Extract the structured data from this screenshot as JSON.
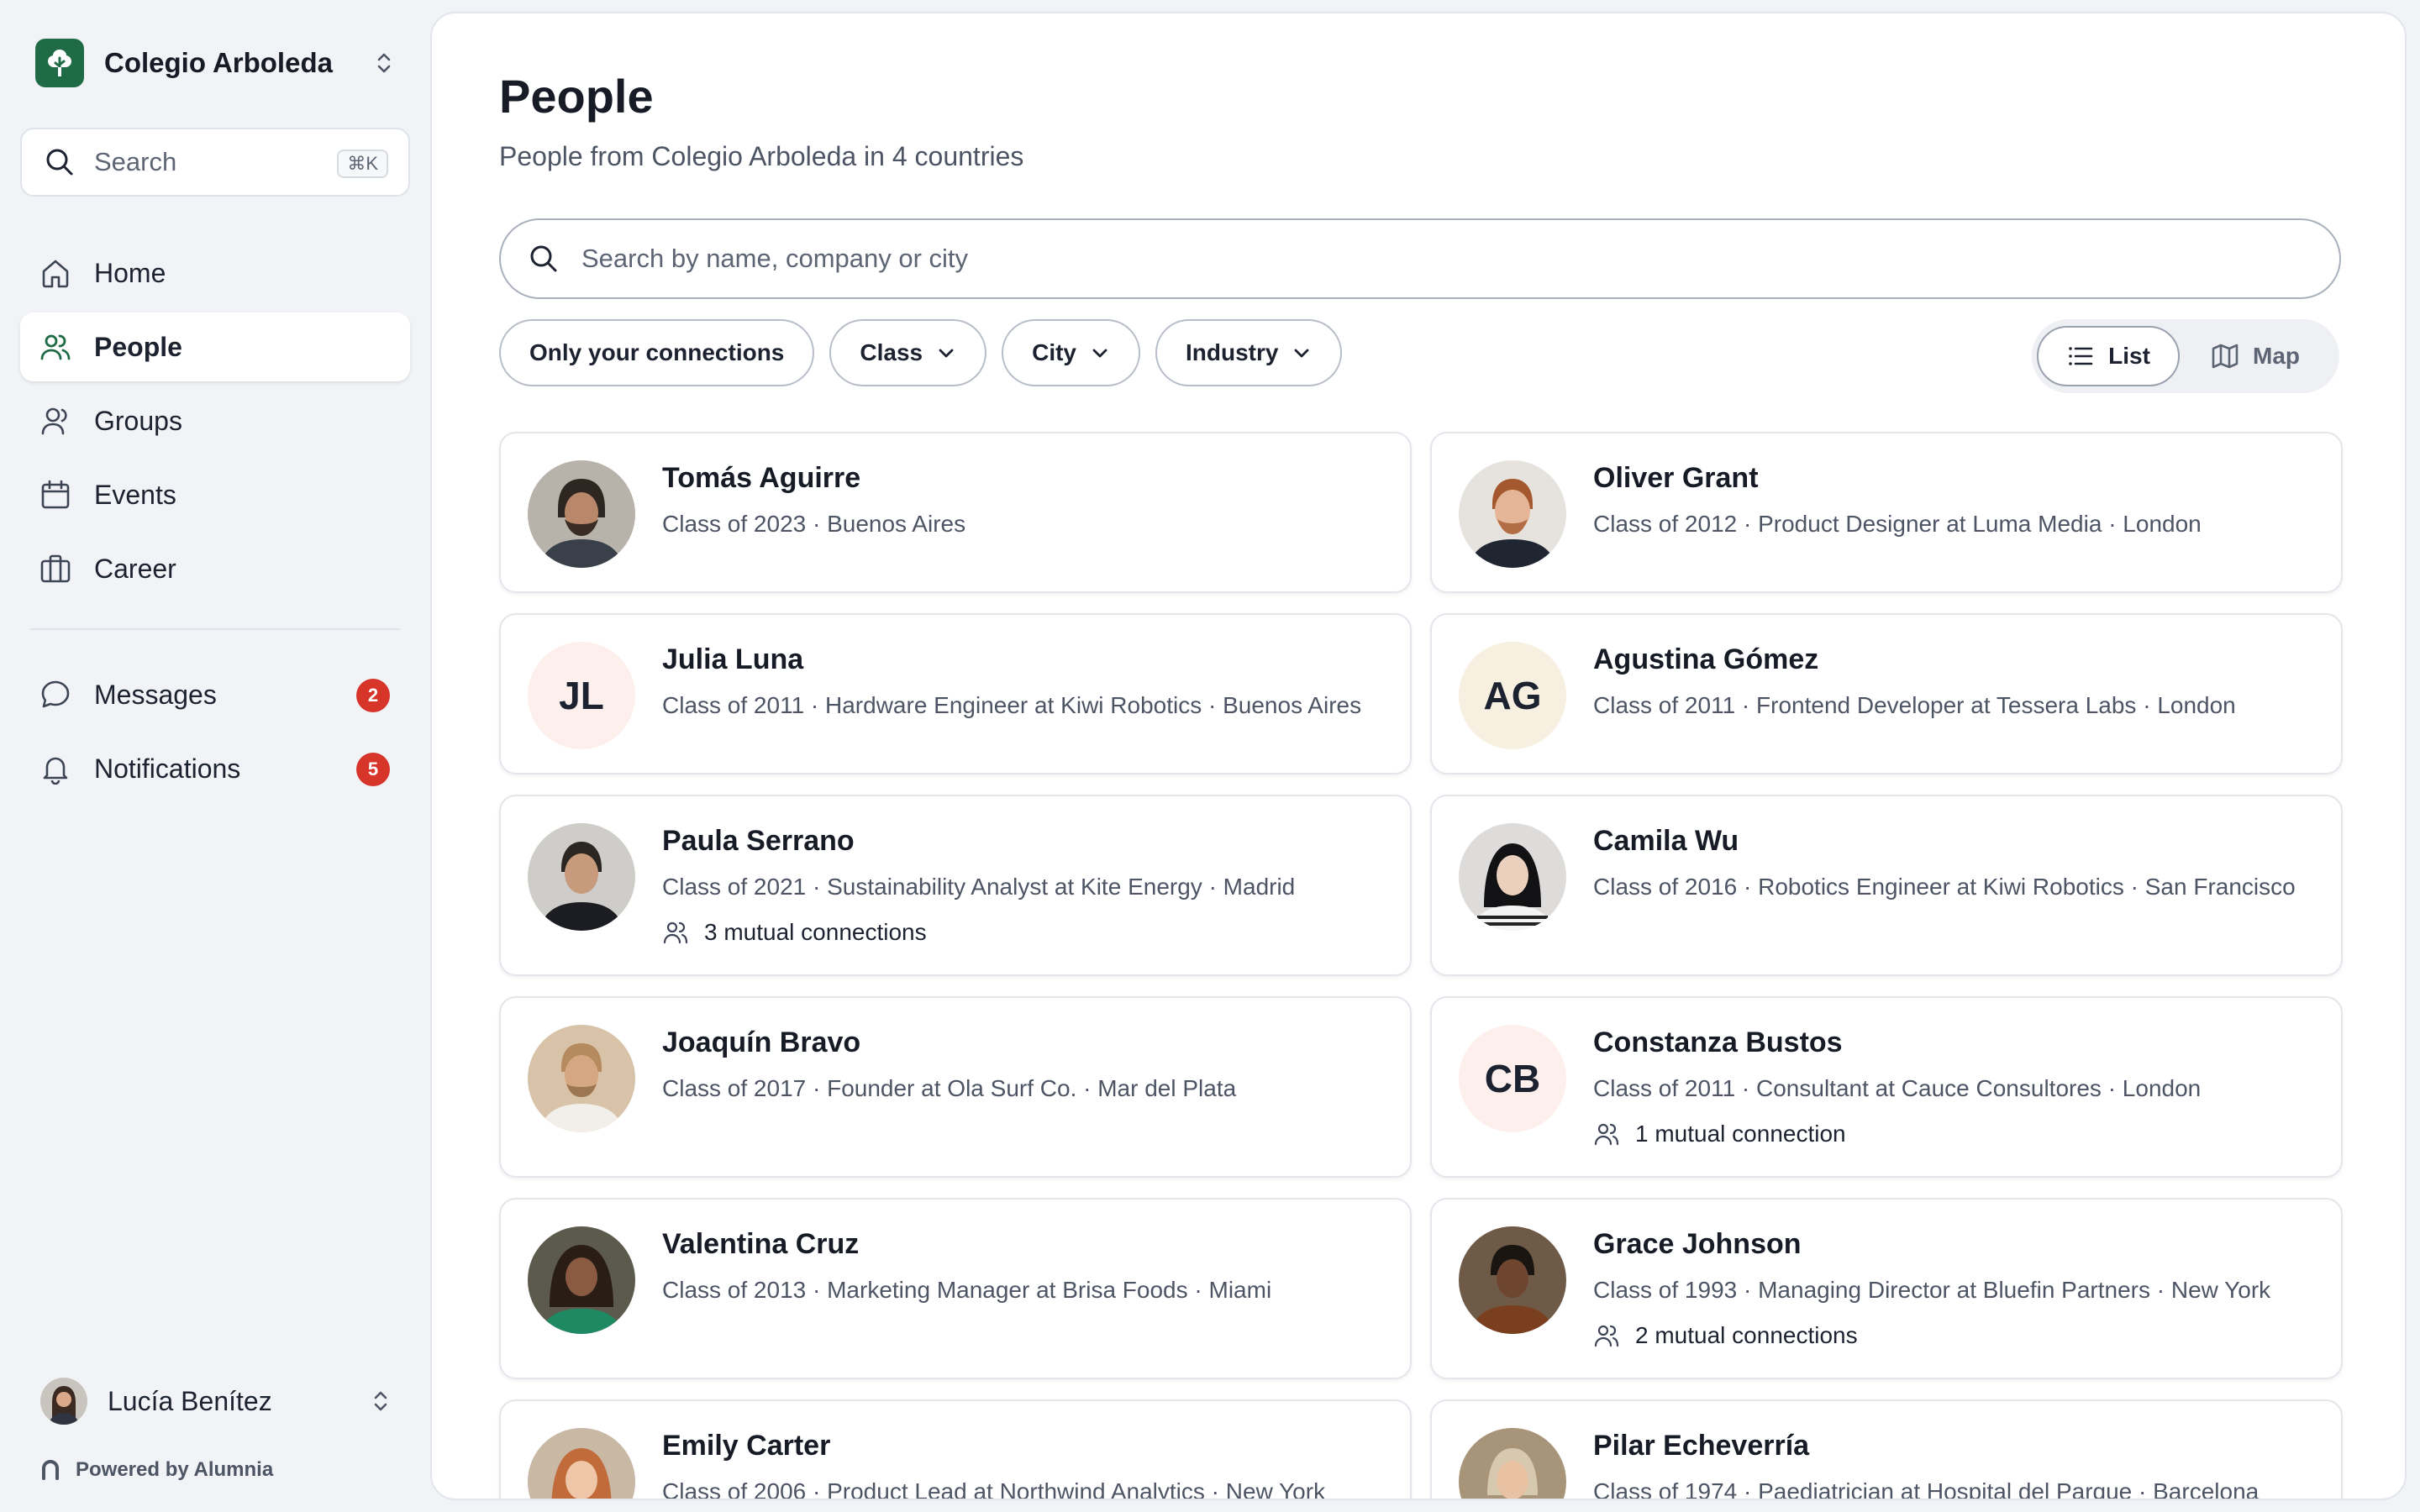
{
  "org": {
    "name": "Colegio Arboleda"
  },
  "sidebar": {
    "search_placeholder": "Search",
    "search_shortcut": "⌘K",
    "nav": [
      {
        "label": "Home",
        "icon": "home-icon"
      },
      {
        "label": "People",
        "icon": "people-icon",
        "active": true
      },
      {
        "label": "Groups",
        "icon": "groups-icon"
      },
      {
        "label": "Events",
        "icon": "calendar-icon"
      },
      {
        "label": "Career",
        "icon": "briefcase-icon"
      }
    ],
    "secondary": [
      {
        "label": "Messages",
        "icon": "chat-bubble-icon",
        "badge": "2"
      },
      {
        "label": "Notifications",
        "icon": "bell-icon",
        "badge": "5"
      }
    ],
    "user": {
      "name": "Lucía Benítez"
    },
    "powered_by": "Powered by Alumnia"
  },
  "main": {
    "title": "People",
    "subtitle": "People from Colegio Arboleda in 4 countries",
    "search_placeholder": "Search by name, company or city",
    "filters": {
      "connections": "Only your connections",
      "class": "Class",
      "city": "City",
      "industry": "Industry"
    },
    "view": {
      "list": "List",
      "map": "Map",
      "selected": "List"
    }
  },
  "people": [
    {
      "name": "Tomás Aguirre",
      "meta": "Class of 2023 · Buenos Aires",
      "avatar": "photo"
    },
    {
      "name": "Oliver Grant",
      "meta": "Class of 2012 · Product Designer at Luma Media · London",
      "avatar": "photo"
    },
    {
      "name": "Julia Luna",
      "meta": "Class of 2011 · Hardware Engineer at Kiwi Robotics · Buenos Aires",
      "initials": "JL",
      "avatar_color": "#fdf0ec"
    },
    {
      "name": "Agustina Gómez",
      "meta": "Class of 2011 · Frontend Developer at Tessera Labs · London",
      "initials": "AG",
      "avatar_color": "#f7f0e0"
    },
    {
      "name": "Paula Serrano",
      "meta": "Class of 2021 · Sustainability Analyst at Kite Energy · Madrid",
      "mutual": "3 mutual connections",
      "avatar": "photo"
    },
    {
      "name": "Camila Wu",
      "meta": "Class of 2016 · Robotics Engineer at Kiwi Robotics · San Francisco",
      "avatar": "photo"
    },
    {
      "name": "Joaquín Bravo",
      "meta": "Class of 2017 · Founder at Ola Surf Co. · Mar del Plata",
      "avatar": "photo"
    },
    {
      "name": "Constanza Bustos",
      "meta": "Class of 2011 · Consultant at Cauce Consultores · London",
      "mutual": "1 mutual connection",
      "initials": "CB",
      "avatar_color": "#fdf0ec"
    },
    {
      "name": "Valentina Cruz",
      "meta": "Class of 2013 · Marketing Manager at Brisa Foods · Miami",
      "avatar": "photo"
    },
    {
      "name": "Grace Johnson",
      "meta": "Class of 1993 · Managing Director at Bluefin Partners · New York",
      "mutual": "2 mutual connections",
      "avatar": "photo"
    },
    {
      "name": "Emily Carter",
      "meta": "Class of 2006 · Product Lead at Northwind Analytics · New York",
      "avatar": "photo"
    },
    {
      "name": "Pilar Echeverría",
      "meta": "Class of 1974 · Paediatrician at Hospital del Parque · Barcelona",
      "avatar": "photo"
    }
  ]
}
